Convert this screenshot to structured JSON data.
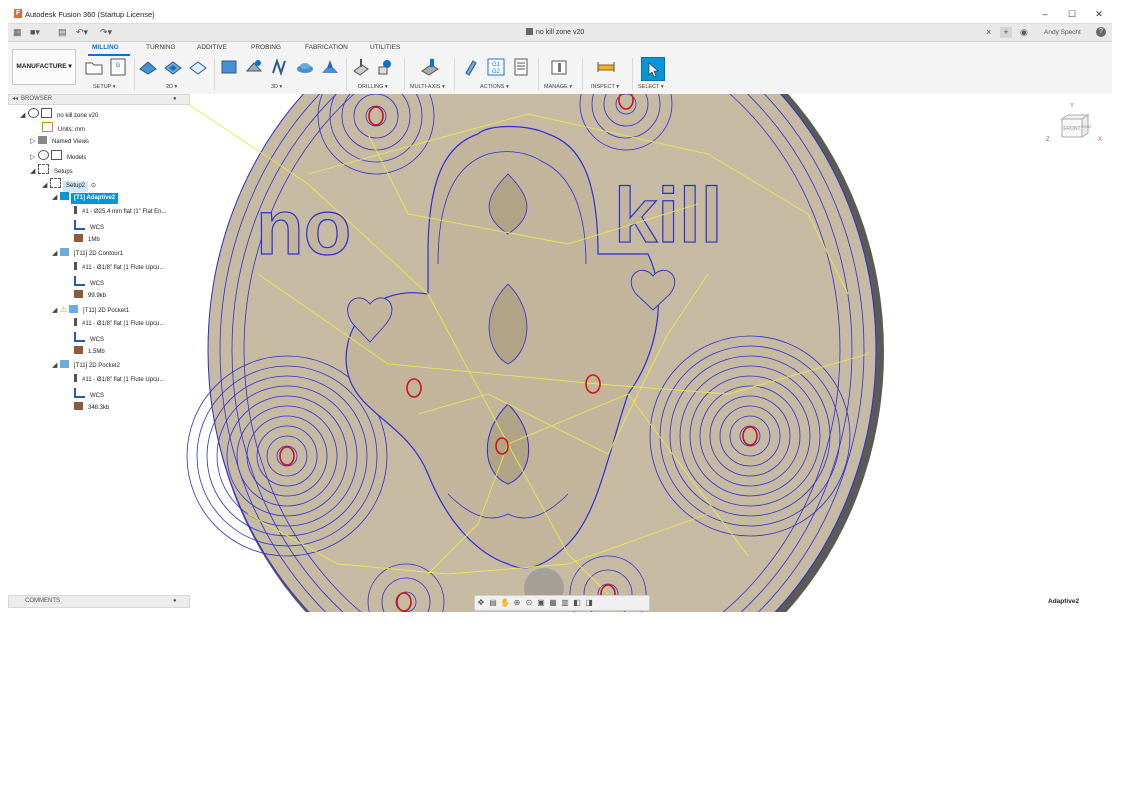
{
  "window": {
    "title": "Autodesk Fusion 360 (Startup License)",
    "min": "–",
    "max": "☐",
    "close": "✕"
  },
  "tabbar": {
    "doc_title": "no kill zone v20",
    "user": "Andy Specht",
    "close": "×",
    "add": "+",
    "help": "?"
  },
  "ribbon": {
    "workspace": "MANUFACTURE ▾",
    "tabs": [
      {
        "label": "MILLING"
      },
      {
        "label": "TURNING"
      },
      {
        "label": "ADDITIVE"
      },
      {
        "label": "PROBING"
      },
      {
        "label": "FABRICATION"
      },
      {
        "label": "UTILITIES"
      }
    ],
    "groups": [
      {
        "label": "SETUP ▾"
      },
      {
        "label": "2D ▾"
      },
      {
        "label": "3D ▾"
      },
      {
        "label": "DRILLING ▾"
      },
      {
        "label": "MULTI-AXIS ▾"
      },
      {
        "label": "ACTIONS ▾"
      },
      {
        "label": "MANAGE ▾"
      },
      {
        "label": "INSPECT ▾"
      },
      {
        "label": "SELECT ▾"
      }
    ]
  },
  "browser": {
    "header": "BROWSER",
    "root": "no kill zone v20",
    "units": "Units: mm",
    "named_views": "Named Views",
    "models": "Models",
    "setups": "Setups",
    "setup2": "Setup2",
    "ops": [
      {
        "label": "[T1] Adaptive2",
        "tool": "#1 - Ø25.4 mm flat (1\" Flat En...",
        "wcs": "WCS",
        "size": "1Mb"
      },
      {
        "label": "[T11] 2D Contour1",
        "tool": "#11 - Ø1/8\" flat (1 Flute Upcu...",
        "wcs": "WCS",
        "size": "99.9kb"
      },
      {
        "label": "[T11] 2D Pocket1",
        "tool": "#11 - Ø1/8\" flat (1 Flute Upcu...",
        "wcs": "WCS",
        "size": "1.5Mb"
      },
      {
        "label": "[T11] 2D Pocket2",
        "tool": "#11 - Ø1/8\" flat (1 Flute Upcu...",
        "wcs": "WCS",
        "size": "348.3kb"
      }
    ]
  },
  "comments": "COMMENTS",
  "viewcube": {
    "front": "FRONT",
    "right": "RIGH",
    "x": "X",
    "y": "Y",
    "z": "Z"
  },
  "viewport_text": {
    "no": "no",
    "kill": "kill"
  },
  "status": "Adaptive2",
  "colors": {
    "accent": "#0696d7",
    "stock": "#c7baa2",
    "toolpath_blue": "#2b2fd6",
    "toolpath_yellow": "#e8e84a",
    "drill_red": "#d01515"
  }
}
